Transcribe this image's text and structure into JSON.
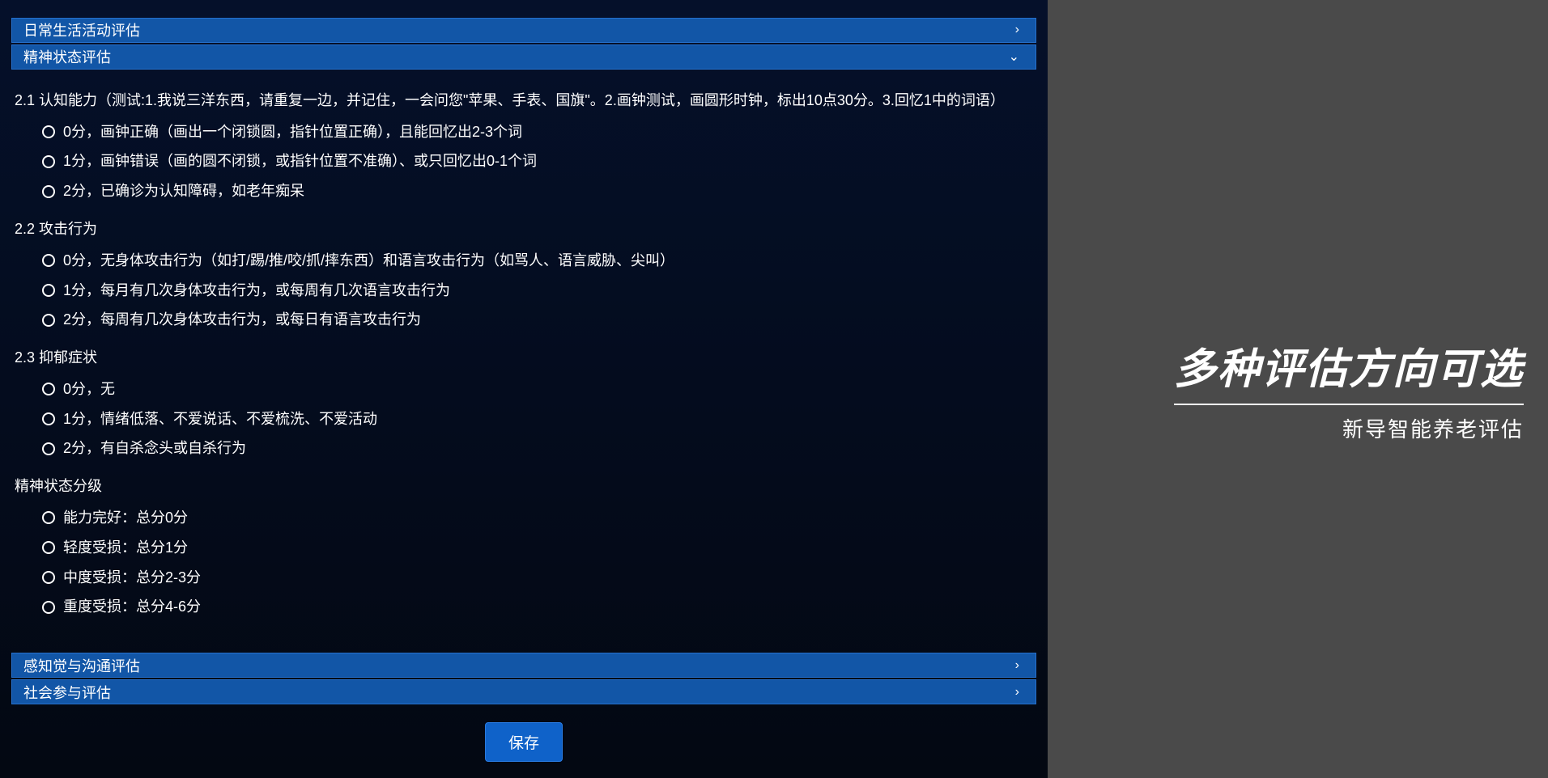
{
  "leftPanel": {
    "accordion": {
      "section1": {
        "title": "日常生活活动评估"
      },
      "section2": {
        "title": "精神状态评估",
        "q1": {
          "title": "2.1 认知能力（测试:1.我说三洋东西，请重复一边，并记住，一会问您\"苹果、手表、国旗\"。2.画钟测试，画圆形时钟，标出10点30分。3.回忆1中的词语）",
          "opt0": "0分，画钟正确（画出一个闭锁圆，指针位置正确），且能回忆出2-3个词",
          "opt1": "1分，画钟错误（画的圆不闭锁，或指针位置不准确）、或只回忆出0-1个词",
          "opt2": "2分，已确诊为认知障碍，如老年痴呆"
        },
        "q2": {
          "title": "2.2 攻击行为",
          "opt0": "0分，无身体攻击行为（如打/踢/推/咬/抓/摔东西）和语言攻击行为（如骂人、语言威胁、尖叫）",
          "opt1": "1分，每月有几次身体攻击行为，或每周有几次语言攻击行为",
          "opt2": "2分，每周有几次身体攻击行为，或每日有语言攻击行为"
        },
        "q3": {
          "title": "2.3 抑郁症状",
          "opt0": "0分，无",
          "opt1": "1分，情绪低落、不爱说话、不爱梳洗、不爱活动",
          "opt2": "2分，有自杀念头或自杀行为"
        },
        "grading": {
          "title": "精神状态分级",
          "opt0": "能力完好：总分0分",
          "opt1": "轻度受损：总分1分",
          "opt2": "中度受损：总分2-3分",
          "opt3": "重度受损：总分4-6分"
        }
      },
      "section3": {
        "title": "感知觉与沟通评估"
      },
      "section4": {
        "title": "社会参与评估"
      }
    },
    "saveButton": "保存"
  },
  "rightPanel": {
    "title": "多种评估方向可选",
    "subtitle": "新导智能养老评估"
  }
}
